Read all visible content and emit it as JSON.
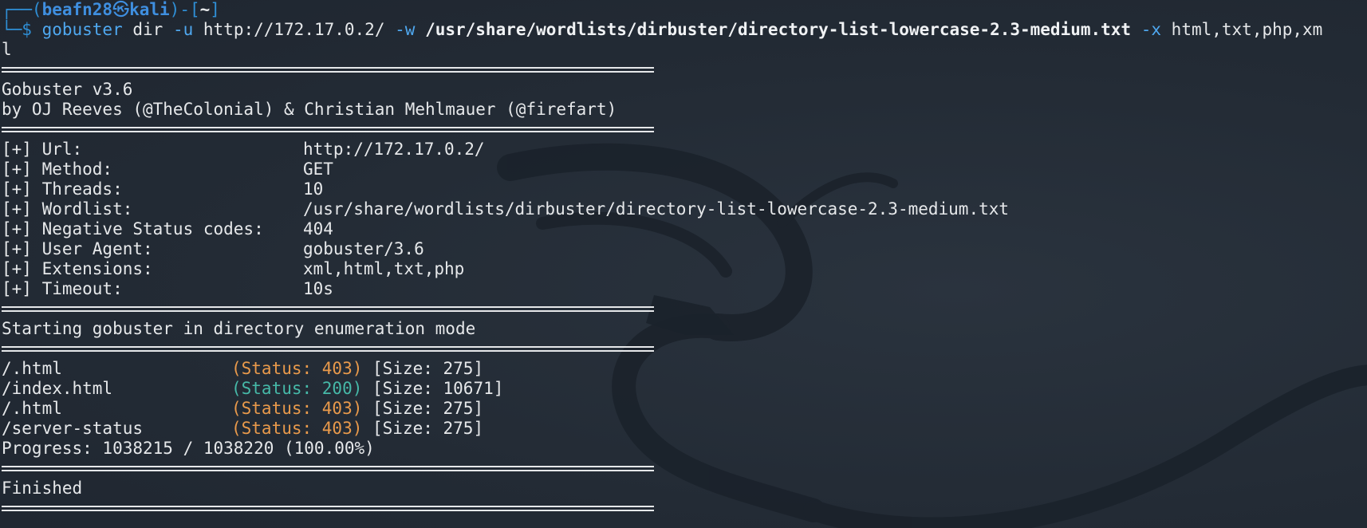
{
  "prompt": {
    "frame_top": "┌──(",
    "user": "beafn28",
    "skull": "㉿",
    "host": "kali",
    "mid": ")-[",
    "cwd": "~",
    "end": "]",
    "frame_bottom": "└─$ "
  },
  "command": {
    "bin": "gobuster",
    "sub": " dir ",
    "flag_u": "-u",
    "url": " http://172.17.0.2/ ",
    "flag_w": "-w",
    "wordlist": " /usr/share/wordlists/dirbuster/directory-list-lowercase-2.3-medium.txt ",
    "flag_x": "-x",
    "ext": " html,txt,php,xm",
    "wrap": "l"
  },
  "banner": {
    "version": "Gobuster v3.6",
    "authors": "by OJ Reeves (@TheColonial) & Christian Mehlmauer (@firefart)"
  },
  "config": [
    {
      "key": "[+] Url:",
      "value": "http://172.17.0.2/"
    },
    {
      "key": "[+] Method:",
      "value": "GET"
    },
    {
      "key": "[+] Threads:",
      "value": "10"
    },
    {
      "key": "[+] Wordlist:",
      "value": "/usr/share/wordlists/dirbuster/directory-list-lowercase-2.3-medium.txt"
    },
    {
      "key": "[+] Negative Status codes:",
      "value": "404"
    },
    {
      "key": "[+] User Agent:",
      "value": "gobuster/3.6"
    },
    {
      "key": "[+] Extensions:",
      "value": "xml,html,txt,php"
    },
    {
      "key": "[+] Timeout:",
      "value": "10s"
    }
  ],
  "mode_line": "Starting gobuster in directory enumeration mode",
  "results": [
    {
      "path": "/.html",
      "status": "(Status: 403)",
      "size": " [Size: 275]"
    },
    {
      "path": "/index.html",
      "status": "(Status: 200)",
      "size": " [Size: 10671]"
    },
    {
      "path": "/.html",
      "status": "(Status: 403)",
      "size": " [Size: 275]"
    },
    {
      "path": "/server-status",
      "status": "(Status: 403)",
      "size": " [Size: 275]"
    }
  ],
  "progress": "Progress: 1038215 / 1038220 (100.00%)",
  "finished": "Finished",
  "colors": {
    "background": "#232b35",
    "text": "#e6e8ea",
    "prompt_blue": "#3f8fe0",
    "status_403": "#e99a4b",
    "status_200": "#46b9a8"
  },
  "icons": {
    "background_watermark": "kali-dragon-icon"
  }
}
